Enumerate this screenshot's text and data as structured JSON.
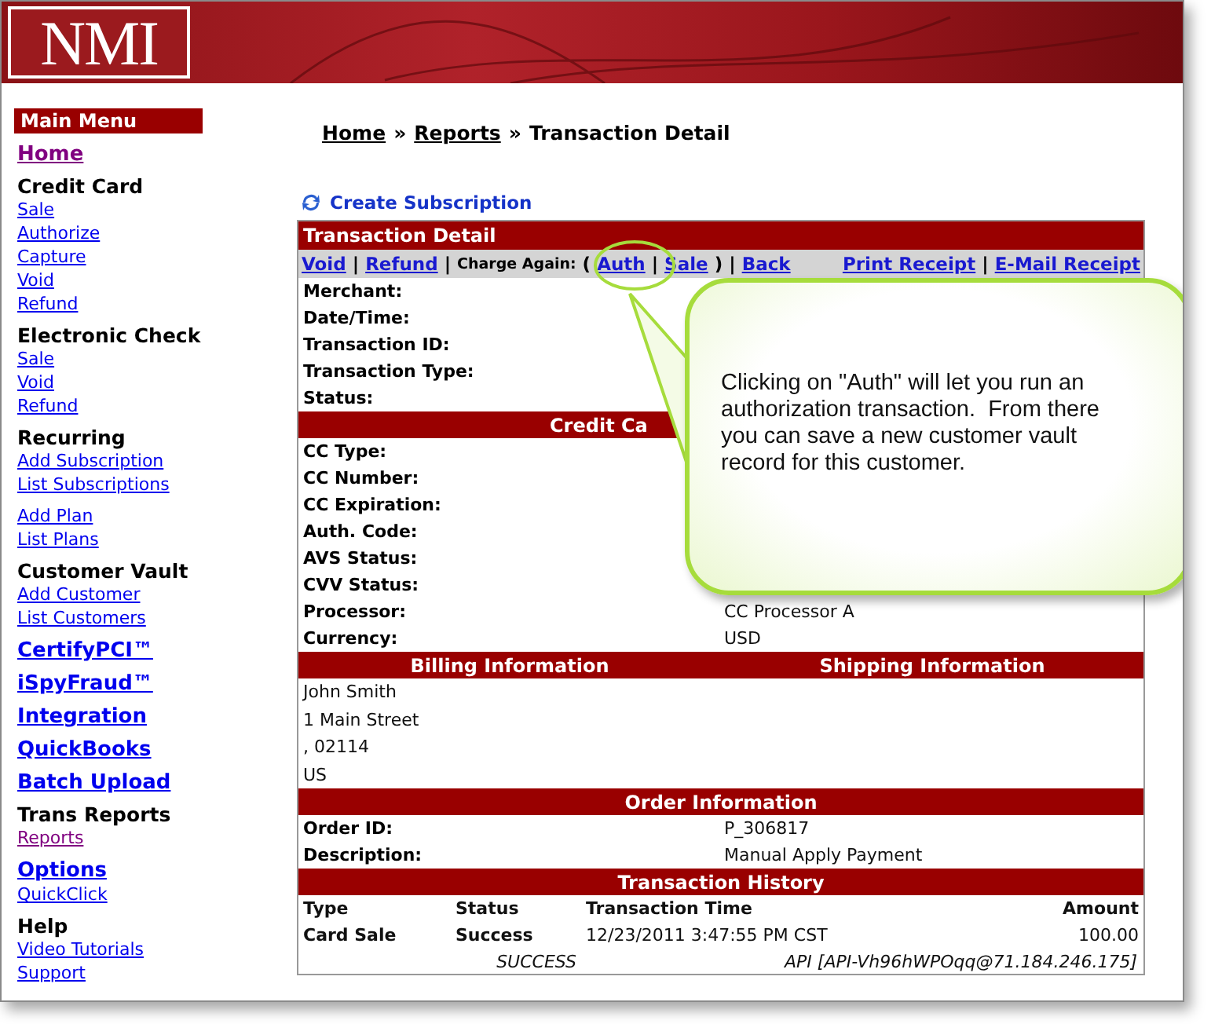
{
  "logo": "NMI",
  "sidebar": {
    "items": [
      {
        "kind": "title",
        "text": "Main Menu"
      },
      {
        "kind": "major-link",
        "text": "Home",
        "visited": true
      },
      {
        "kind": "heading",
        "text": "Credit Card"
      },
      {
        "kind": "link",
        "text": "Sale",
        "visited": false
      },
      {
        "kind": "link",
        "text": "Authorize",
        "visited": false
      },
      {
        "kind": "link",
        "text": "Capture",
        "visited": false
      },
      {
        "kind": "link",
        "text": "Void",
        "visited": false
      },
      {
        "kind": "link",
        "text": "Refund",
        "visited": false
      },
      {
        "kind": "heading",
        "text": "Electronic Check"
      },
      {
        "kind": "link",
        "text": "Sale",
        "visited": false
      },
      {
        "kind": "link",
        "text": "Void",
        "visited": false
      },
      {
        "kind": "link",
        "text": "Refund",
        "visited": false
      },
      {
        "kind": "heading",
        "text": "Recurring"
      },
      {
        "kind": "link",
        "text": "Add Subscription",
        "visited": false
      },
      {
        "kind": "link",
        "text": "List Subscriptions",
        "visited": false
      },
      {
        "kind": "link",
        "text": "Add Plan",
        "visited": false,
        "spaced": true
      },
      {
        "kind": "link",
        "text": "List Plans",
        "visited": false
      },
      {
        "kind": "heading",
        "text": "Customer Vault"
      },
      {
        "kind": "link",
        "text": "Add Customer",
        "visited": false
      },
      {
        "kind": "link",
        "text": "List Customers",
        "visited": false
      },
      {
        "kind": "major-link",
        "text": "CertifyPCI™",
        "visited": false
      },
      {
        "kind": "major-link",
        "text": "iSpyFraud™",
        "visited": false
      },
      {
        "kind": "major-link",
        "text": "Integration",
        "visited": false
      },
      {
        "kind": "major-link",
        "text": "QuickBooks",
        "visited": false
      },
      {
        "kind": "major-link",
        "text": "Batch Upload",
        "visited": false
      },
      {
        "kind": "heading",
        "text": "Trans Reports"
      },
      {
        "kind": "link",
        "text": "Reports",
        "visited": true
      },
      {
        "kind": "major-link",
        "text": "Options",
        "visited": false
      },
      {
        "kind": "link",
        "text": "QuickClick",
        "visited": false
      },
      {
        "kind": "heading",
        "text": "Help"
      },
      {
        "kind": "link",
        "text": "Video Tutorials",
        "visited": false
      },
      {
        "kind": "link",
        "text": "Support",
        "visited": false
      }
    ]
  },
  "breadcrumb": [
    {
      "kind": "link",
      "text": "Home"
    },
    {
      "kind": "text",
      "text": "»"
    },
    {
      "kind": "link",
      "text": "Reports"
    },
    {
      "kind": "text",
      "text": "»"
    },
    {
      "kind": "text",
      "text": "Transaction Detail"
    }
  ],
  "create_subscription": "Create Subscription",
  "panel": {
    "title": "Transaction Detail",
    "actions_left": [
      {
        "kind": "link",
        "text": "Void"
      },
      {
        "kind": "text",
        "text": "|"
      },
      {
        "kind": "link",
        "text": "Refund"
      },
      {
        "kind": "text",
        "text": "|"
      },
      {
        "kind": "label",
        "text": "Charge Again:"
      },
      {
        "kind": "text",
        "text": "("
      },
      {
        "kind": "link",
        "text": "Auth"
      },
      {
        "kind": "text",
        "text": "|"
      },
      {
        "kind": "link",
        "text": "Sale"
      },
      {
        "kind": "text",
        "text": ")"
      },
      {
        "kind": "text",
        "text": "|"
      },
      {
        "kind": "link",
        "text": "Back"
      }
    ],
    "actions_right": [
      {
        "kind": "link",
        "text": "Print Receipt"
      },
      {
        "kind": "text",
        "text": "|"
      },
      {
        "kind": "link",
        "text": "E-Mail Receipt"
      }
    ],
    "sections": [
      {
        "kind": "fields",
        "rows": [
          {
            "label": "Merchant:"
          },
          {
            "label": "Date/Time:"
          },
          {
            "label": "Transaction ID:"
          },
          {
            "label": "Transaction Type:"
          },
          {
            "label": "Status:"
          }
        ]
      },
      {
        "kind": "header-partial",
        "titles": [
          "Credit Ca"
        ]
      },
      {
        "kind": "fields",
        "rows": [
          {
            "label": "CC Type:"
          },
          {
            "label": "CC Number:"
          },
          {
            "label": "CC Expiration:"
          },
          {
            "label": "Auth. Code:"
          },
          {
            "label": "AVS Status:"
          },
          {
            "label": "CVV Status:"
          },
          {
            "label": "Processor:",
            "value": "CC Processor A"
          },
          {
            "label": "Currency:",
            "value": "USD"
          }
        ]
      },
      {
        "kind": "header",
        "titles": [
          "Billing Information",
          "Shipping Information"
        ]
      },
      {
        "kind": "lines",
        "lines": [
          "John Smith",
          "1 Main Street",
          ", 02114",
          "US"
        ]
      },
      {
        "kind": "header",
        "titles": [
          "Order Information"
        ]
      },
      {
        "kind": "fields",
        "rows": [
          {
            "label": "Order ID:",
            "value": "P_306817"
          },
          {
            "label": "Description:",
            "value": "Manual Apply Payment"
          }
        ]
      },
      {
        "kind": "header",
        "titles": [
          "Transaction History"
        ]
      },
      {
        "kind": "history",
        "columns": [
          "Type",
          "Status",
          "Transaction Time",
          "Amount"
        ],
        "rows": [
          [
            "Card Sale",
            "Success",
            "12/23/2011 3:47:55 PM CST",
            "100.00"
          ]
        ],
        "note": [
          "SUCCESS",
          "API [API-Vh96hWPOqq@71.184.246.175]"
        ]
      }
    ]
  },
  "callout": {
    "text": "Clicking on \"Auth\" will let you run an authorization transaction.  From there you can save a new customer vault record for this customer."
  }
}
